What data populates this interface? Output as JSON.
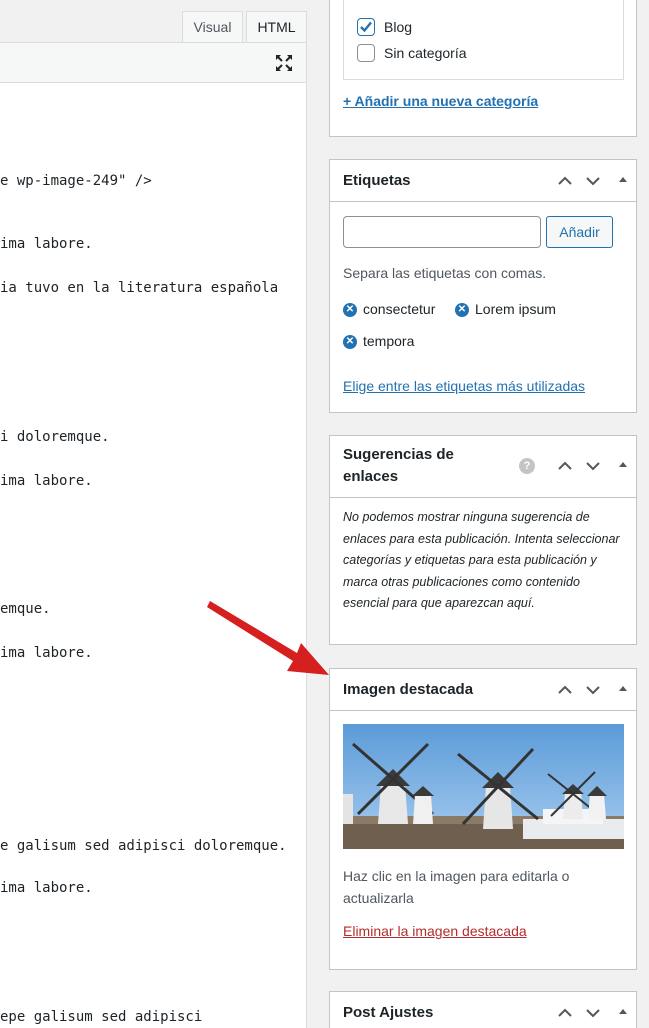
{
  "editor": {
    "tab_visual": "Visual",
    "tab_html": "HTML",
    "lines": [
      "e wp-image-249\" />",
      "ima labore.",
      "ia tuvo en la literatura española",
      "i doloremque.",
      "ima labore.",
      "emque.",
      "ima labore.",
      "e galisum sed adipisci doloremque.",
      "ima labore.",
      "epe galisum sed adipisci"
    ]
  },
  "categories": {
    "items": [
      {
        "label": "Blog",
        "checked": true
      },
      {
        "label": "Sin categoría",
        "checked": false
      }
    ],
    "add_link": "+ Añadir una nueva categoría"
  },
  "tags": {
    "title": "Etiquetas",
    "input_placeholder": "",
    "add_button": "Añadir",
    "hint": "Separa las etiquetas con comas.",
    "items": [
      "consectetur",
      "Lorem ipsum",
      "tempora"
    ],
    "choose_link": "Elige entre las etiquetas más utilizadas"
  },
  "suggestions": {
    "title": "Sugerencias de enlaces",
    "help_icon": "?",
    "text": "No podemos mostrar ninguna sugerencia de enlaces para esta publicación. Intenta seleccionar categorías y etiquetas para esta publicación y marca otras publicaciones como contenido esencial para que aparezcan aquí."
  },
  "featured_image": {
    "title": "Imagen destacada",
    "caption": "Haz clic en la imagen para editarla o actualizarla",
    "remove_link": "Eliminar la imagen destacada"
  },
  "post_settings": {
    "title": "Post Ajustes"
  },
  "colors": {
    "accent": "#2271b1",
    "danger": "#b32d2e",
    "arrow": "#d61f1f"
  }
}
